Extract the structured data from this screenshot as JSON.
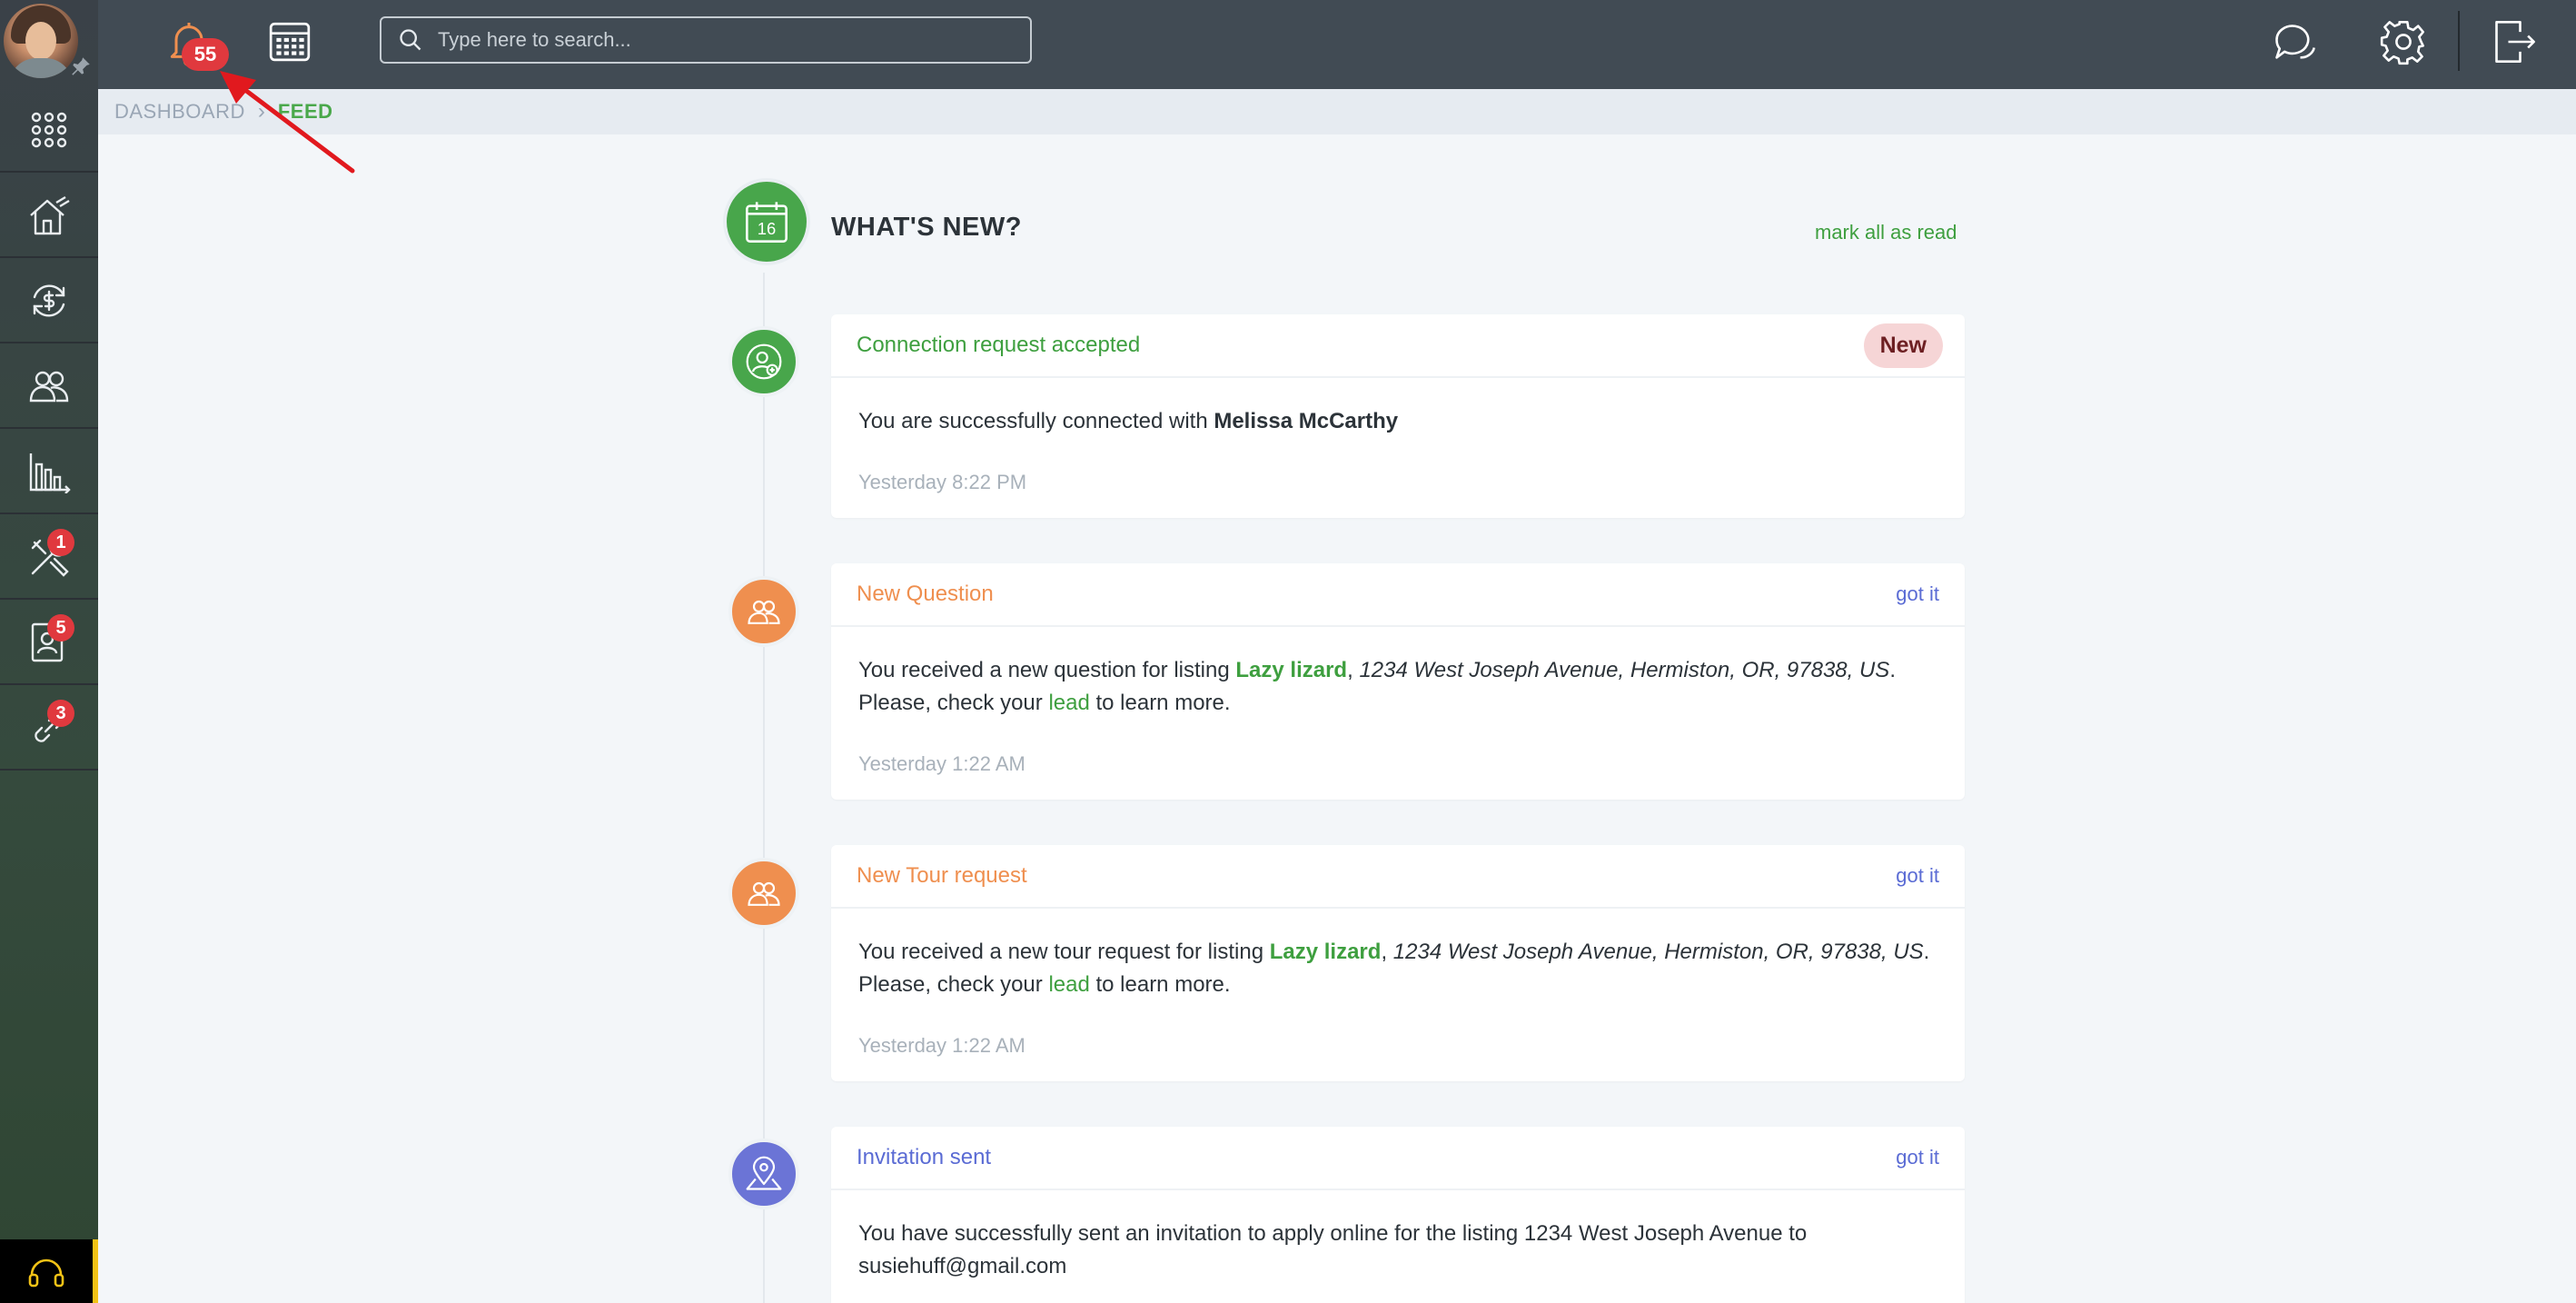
{
  "topbar": {
    "notification_count": "55",
    "search_placeholder": "Type here to search..."
  },
  "sidebar": {
    "badges": {
      "tools": "1",
      "contacts": "5",
      "links": "3"
    }
  },
  "breadcrumb": {
    "dashboard": "DASHBOARD",
    "separator": "›",
    "current": "FEED"
  },
  "feed": {
    "title": "WHAT'S NEW?",
    "mark_all": "mark all as read",
    "items": [
      {
        "title": "Connection request accepted",
        "action": "New",
        "body_prefix": "You are successfully connected with ",
        "body_name": "Melissa McCarthy",
        "time": "Yesterday 8:22 PM"
      },
      {
        "title": "New Question",
        "action": "got it",
        "body_prefix": "You received a new question for listing ",
        "listing": "Lazy lizard",
        "comma": ", ",
        "address": "1234 West Joseph Avenue, Hermiston, OR, 97838, US",
        "mid": ". Please, check your ",
        "lead": "lead",
        "suffix": " to learn more.",
        "time": "Yesterday 1:22 AM"
      },
      {
        "title": "New Tour request",
        "action": "got it",
        "body_prefix": "You received a new tour request for listing ",
        "listing": "Lazy lizard",
        "comma": ", ",
        "address": "1234 West Joseph Avenue, Hermiston, OR, 97838, US",
        "mid": ". Please, check your ",
        "lead": "lead",
        "suffix": " to learn more.",
        "time": "Yesterday 1:22 AM"
      },
      {
        "title": "Invitation sent",
        "action": "got it",
        "body": "You have successfully sent an invitation to apply online for the listing 1234 West Joseph Avenue to susiehuff@gmail.com"
      }
    ]
  },
  "colors": {
    "green": "#48a64b",
    "orange": "#ef8f4f",
    "purple": "#6b74d6",
    "badge_red": "#e0393e"
  }
}
